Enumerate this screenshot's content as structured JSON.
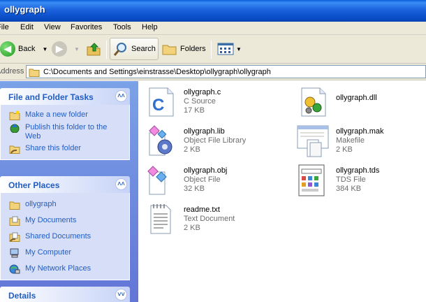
{
  "window": {
    "title": "ollygraph"
  },
  "menu": {
    "items": [
      "File",
      "Edit",
      "View",
      "Favorites",
      "Tools",
      "Help"
    ]
  },
  "toolbar": {
    "back": "Back",
    "search": "Search",
    "folders": "Folders"
  },
  "address": {
    "label": "Address",
    "path": "C:\\Documents and Settings\\einstrasse\\Desktop\\ollygraph\\ollygraph"
  },
  "tasks_panel": {
    "title": "File and Folder Tasks",
    "items": [
      {
        "label": "Make a new folder",
        "icon": "new-folder-icon"
      },
      {
        "label": "Publish this folder to the Web",
        "icon": "publish-web-icon"
      },
      {
        "label": "Share this folder",
        "icon": "share-folder-icon"
      }
    ]
  },
  "other_places": {
    "title": "Other Places",
    "items": [
      {
        "label": "ollygraph",
        "icon": "folder-icon"
      },
      {
        "label": "My Documents",
        "icon": "my-documents-icon"
      },
      {
        "label": "Shared Documents",
        "icon": "shared-documents-icon"
      },
      {
        "label": "My Computer",
        "icon": "my-computer-icon"
      },
      {
        "label": "My Network Places",
        "icon": "network-places-icon"
      }
    ]
  },
  "details": {
    "title": "Details"
  },
  "files": [
    {
      "name": "ollygraph.c",
      "type": "C Source",
      "size": "17 KB",
      "icon": "c-source-file-icon"
    },
    {
      "name": "ollygraph.dll",
      "type": "",
      "size": "",
      "icon": "dll-file-icon"
    },
    {
      "name": "ollygraph.lib",
      "type": "Object File Library",
      "size": "2 KB",
      "icon": "library-file-icon"
    },
    {
      "name": "ollygraph.mak",
      "type": "Makefile",
      "size": "2 KB",
      "icon": "makefile-icon"
    },
    {
      "name": "ollygraph.obj",
      "type": "Object File",
      "size": "32 KB",
      "icon": "object-file-icon"
    },
    {
      "name": "ollygraph.tds",
      "type": "TDS File",
      "size": "384 KB",
      "icon": "tds-file-icon"
    },
    {
      "name": "readme.txt",
      "type": "Text Document",
      "size": "2 KB",
      "icon": "text-document-icon"
    }
  ]
}
